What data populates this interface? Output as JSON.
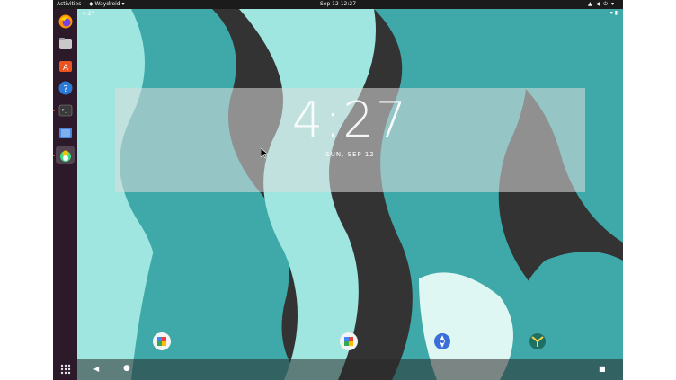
{
  "topbar": {
    "activities": "Activities",
    "app_menu": "Waydroid",
    "clock": "Sep 12  12:27",
    "tray_icons": [
      "network-icon",
      "volume-icon",
      "power-icon"
    ]
  },
  "dock": {
    "items": [
      {
        "name": "firefox",
        "icon": "firefox-icon"
      },
      {
        "name": "files",
        "icon": "folder-icon"
      },
      {
        "name": "software",
        "icon": "store-icon"
      },
      {
        "name": "help",
        "icon": "help-icon"
      },
      {
        "name": "terminal",
        "icon": "terminal-icon"
      },
      {
        "name": "screenshot",
        "icon": "screen-icon"
      },
      {
        "name": "waydroid",
        "icon": "android-icon"
      }
    ],
    "apps_grid_icon": "grid-icon"
  },
  "android": {
    "status_time": "4:27",
    "clock": "4:27",
    "date": "SUN, SEP 12",
    "colors": {
      "teal": "#3fa9a9",
      "mint": "#9ee6df",
      "dark": "#333333",
      "pale": "#dff7f3"
    }
  }
}
